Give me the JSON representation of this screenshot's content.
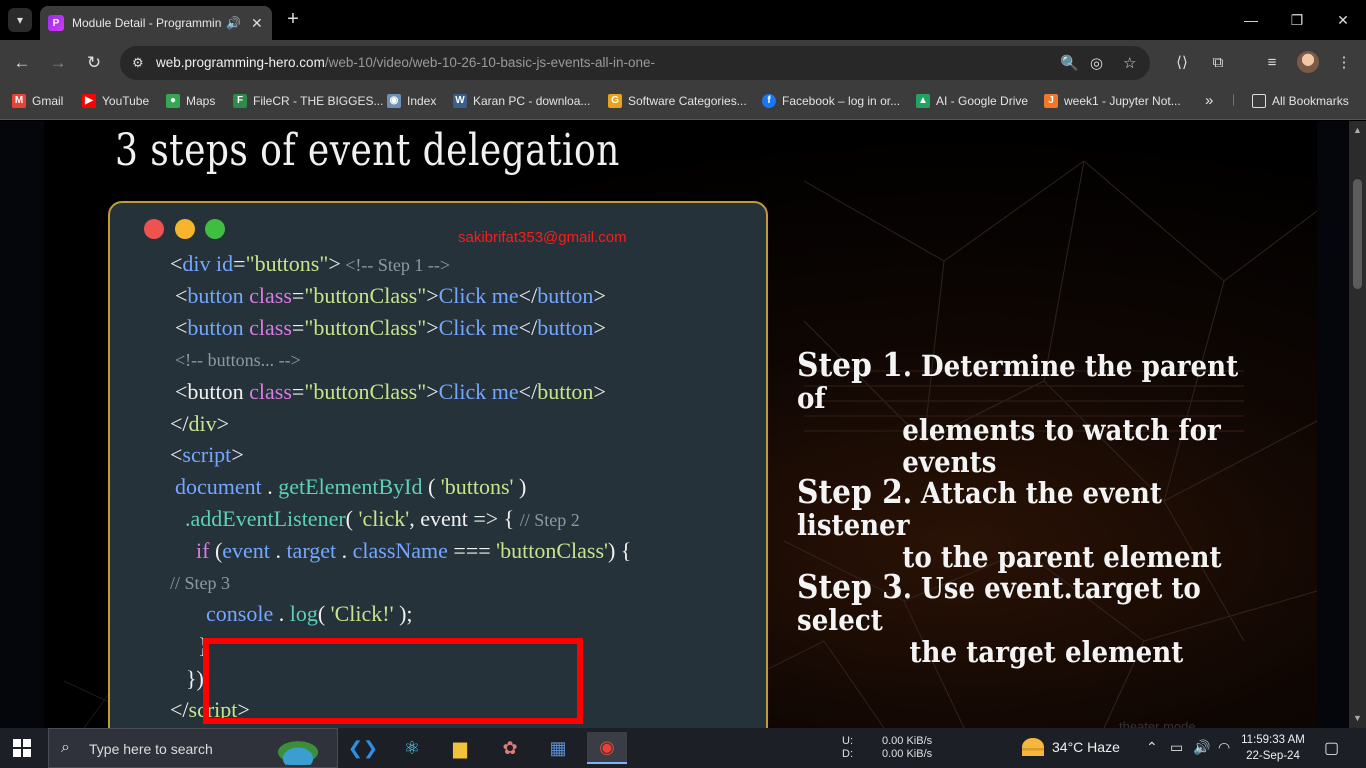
{
  "browser": {
    "tab": {
      "title": "Module Detail - Programming Hero",
      "favicon": "P"
    },
    "url": {
      "host": "web.programming-hero.com",
      "path": "/web-10/video/web-10-26-10-basic-js-events-all-in-one-"
    },
    "bookmarks": [
      {
        "label": "Gmail",
        "icon": "M",
        "color": "#ea4335"
      },
      {
        "label": "YouTube",
        "icon": "▶",
        "color": "#ff0000"
      },
      {
        "label": "Maps",
        "icon": "●",
        "color": "#34a853"
      },
      {
        "label": "FileCR - THE BIGGES...",
        "icon": "F",
        "color": "#2d8a4a"
      },
      {
        "label": "Index",
        "icon": "◉",
        "color": "#6f8fb5"
      },
      {
        "label": "Karan PC - downloa...",
        "icon": "W",
        "color": "#3b5f8a"
      },
      {
        "label": "Software Categories...",
        "icon": "G",
        "color": "#e8a21c"
      },
      {
        "label": "Facebook – log in or...",
        "icon": "f",
        "color": "#1877f2"
      },
      {
        "label": "AI - Google Drive",
        "icon": "▲",
        "color": "#1fa463"
      },
      {
        "label": "week1 - Jupyter Not...",
        "icon": "J",
        "color": "#f37726"
      }
    ],
    "all_bookmarks": "All Bookmarks",
    "more_bookmarks": "»"
  },
  "slide": {
    "title": "3 steps of event delegation",
    "watermark": "sakibrifat353@gmail.com",
    "code": {
      "l1_open": "<",
      "l1_tag": "div",
      "l1_attr": " id",
      "l1_eq": "=",
      "l1_val": "\"buttons\"",
      "l1_close": ">",
      "l1_cmt": " <!-- Step 1 -->",
      "btn_open": "<",
      "btn_tag": "button",
      "btn_attr": " class",
      "btn_eq": "=",
      "btn_val": "\"buttonClass\"",
      "btn_close": ">",
      "btn_text": "Click me",
      "btn_end_open": "</",
      "btn_end_tag": "button",
      "btn_end_close": ">",
      "cmt_buttons": "<!-- buttons... -->",
      "div_end_open": "</",
      "div_end_tag": "div",
      "div_end_close": ">",
      "script_open": "<",
      "script_tag": "script",
      "script_close": ">",
      "doc": "document",
      "dot": " . ",
      "get_by_id": "getElementById",
      "paren_open": " ( ",
      "buttons_str": "'buttons'",
      "paren_close": " )",
      "add_listener": ".addEventListener",
      "paren2": "( ",
      "click_str": "'click'",
      "comma_event": ", event => { ",
      "cmt_step2": "// Step 2",
      "if_kw": "if",
      "if_open": " (",
      "event_word": "event",
      "target_word": "target",
      "classname_word": "className",
      "triple_eq": " === ",
      "btnclass_str": "'buttonClass'",
      "if_close": ") {",
      "cmt_step3": "// Step 3",
      "console_word": "console",
      "log_word": "log",
      "log_open": "( ",
      "click_log": "'Click!'",
      "log_close": " );",
      "brace": "}",
      "close_listener": "});",
      "script_end_open": "</",
      "script_end_tag": "script",
      "script_end_close": ">"
    },
    "steps": [
      {
        "num": "Step 1",
        "line1": ". Determine the parent of",
        "line2": "elements to watch for",
        "line3": "events"
      },
      {
        "num": "Step 2",
        "line1": ". Attach the event listener",
        "line2": "to the  parent element"
      },
      {
        "num": "Step 3",
        "line1": ". Use event.target to select",
        "line2": "the target element"
      }
    ],
    "theater_label": "theater mode"
  },
  "taskbar": {
    "search_placeholder": "Type here to search",
    "net_up_label": "U:",
    "net_down_label": "D:",
    "net_up": "0.00 KiB/s",
    "net_down": "0.00 KiB/s",
    "weather": "34°C  Haze",
    "time": "11:59:33 AM",
    "date": "22-Sep-24"
  },
  "colors": {
    "accent_red": "#ff0000",
    "card_border": "#c29a3c",
    "card_bg": "#25323a"
  }
}
